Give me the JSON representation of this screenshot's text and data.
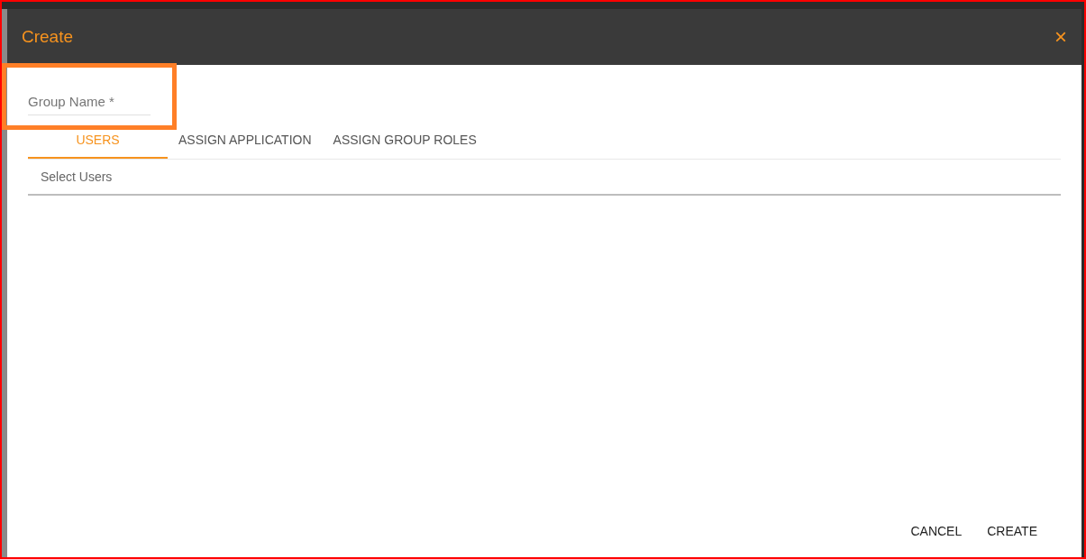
{
  "dialog": {
    "title": "Create",
    "close": "×",
    "group_name": {
      "placeholder": "Group Name *"
    },
    "tabs": [
      {
        "label": "USERS",
        "selected": true
      },
      {
        "label": "ASSIGN APPLICATION",
        "selected": false
      },
      {
        "label": "ASSIGN GROUP ROLES",
        "selected": false
      }
    ],
    "select_users": {
      "placeholder": "Select Users"
    },
    "buttons": [
      "CANCEL",
      "CREATE"
    ]
  }
}
